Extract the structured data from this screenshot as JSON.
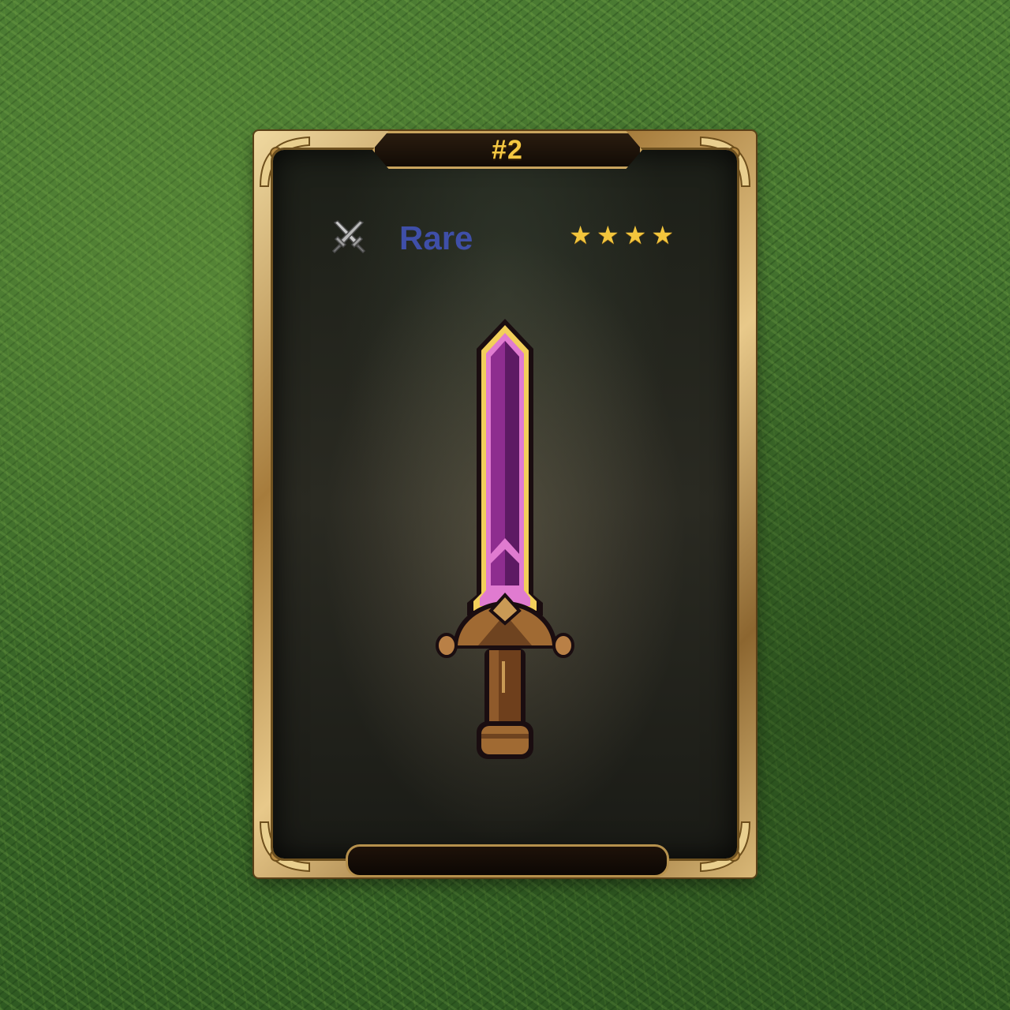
{
  "card": {
    "rank": "#2",
    "rarity": "Rare",
    "rarity_color": "#3f4fa8",
    "stars": 4,
    "star_glyph": "★",
    "class_icon": "crossed-swords-icon",
    "item_icon": "purple-sword-icon",
    "colors": {
      "frame_gold": "#c9a45e",
      "rank_text": "#f5c842",
      "star": "#f3c63d",
      "blade": "#8a2b8f",
      "background": "#3e6a2a"
    }
  }
}
